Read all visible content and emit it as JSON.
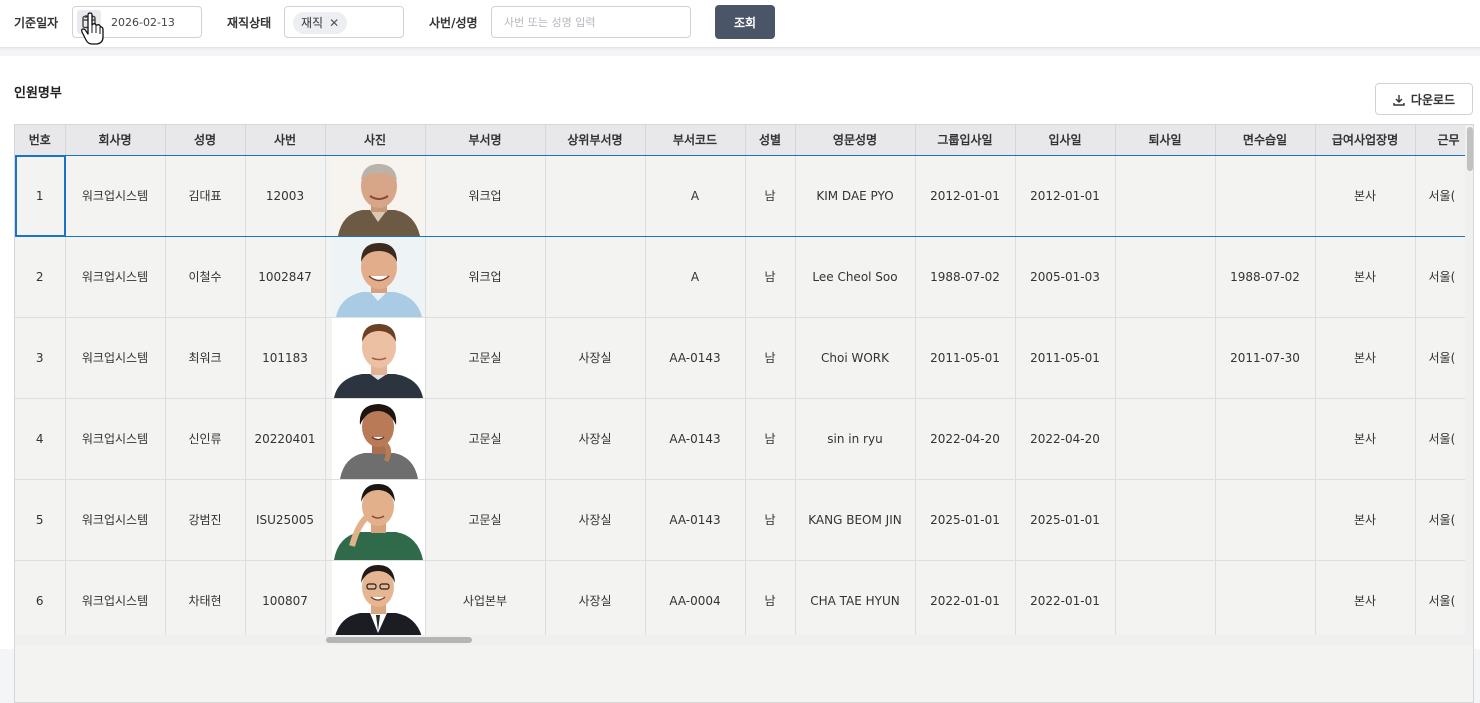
{
  "filters": {
    "date_label": "기준일자",
    "date_value": "2026-02-13",
    "status_label": "재직상태",
    "status_chip": "재직",
    "search_label": "사번/성명",
    "search_placeholder": "사번 또는 성명 입력",
    "search_button": "조회"
  },
  "panel": {
    "title": "인원명부",
    "download_button": "다운로드"
  },
  "table": {
    "columns": [
      "번호",
      "회사명",
      "성명",
      "사번",
      "사진",
      "부서명",
      "상위부서명",
      "부서코드",
      "성별",
      "영문성명",
      "그룹입사일",
      "입사일",
      "퇴사일",
      "면수습일",
      "급여사업장명",
      "근무"
    ],
    "rows": [
      {
        "no": "1",
        "company": "워크업시스템",
        "name": "김대표",
        "emp_no": "12003",
        "dept": "워크업",
        "parent_dept": "",
        "dept_code": "A",
        "gender": "남",
        "eng_name": "KIM DAE PYO",
        "group_join": "2012-01-01",
        "join": "2012-01-01",
        "leave": "",
        "probation_end": "",
        "payroll_site": "본사",
        "work_site": "서울("
      },
      {
        "no": "2",
        "company": "워크업시스템",
        "name": "이철수",
        "emp_no": "1002847",
        "dept": "워크업",
        "parent_dept": "",
        "dept_code": "A",
        "gender": "남",
        "eng_name": "Lee Cheol Soo",
        "group_join": "1988-07-02",
        "join": "2005-01-03",
        "leave": "",
        "probation_end": "1988-07-02",
        "payroll_site": "본사",
        "work_site": "서울("
      },
      {
        "no": "3",
        "company": "워크업시스템",
        "name": "최워크",
        "emp_no": "101183",
        "dept": "고문실",
        "parent_dept": "사장실",
        "dept_code": "AA-0143",
        "gender": "남",
        "eng_name": "Choi WORK",
        "group_join": "2011-05-01",
        "join": "2011-05-01",
        "leave": "",
        "probation_end": "2011-07-30",
        "payroll_site": "본사",
        "work_site": "서울("
      },
      {
        "no": "4",
        "company": "워크업시스템",
        "name": "신인류",
        "emp_no": "20220401",
        "dept": "고문실",
        "parent_dept": "사장실",
        "dept_code": "AA-0143",
        "gender": "남",
        "eng_name": "sin in ryu",
        "group_join": "2022-04-20",
        "join": "2022-04-20",
        "leave": "",
        "probation_end": "",
        "payroll_site": "본사",
        "work_site": "서울("
      },
      {
        "no": "5",
        "company": "워크업시스템",
        "name": "강범진",
        "emp_no": "ISU25005",
        "dept": "고문실",
        "parent_dept": "사장실",
        "dept_code": "AA-0143",
        "gender": "남",
        "eng_name": "KANG BEOM JIN",
        "group_join": "2025-01-01",
        "join": "2025-01-01",
        "leave": "",
        "probation_end": "",
        "payroll_site": "본사",
        "work_site": "서울("
      },
      {
        "no": "6",
        "company": "워크업시스템",
        "name": "차태현",
        "emp_no": "100807",
        "dept": "사업본부",
        "parent_dept": "사장실",
        "dept_code": "AA-0004",
        "gender": "남",
        "eng_name": "CHA TAE HYUN",
        "group_join": "2022-01-01",
        "join": "2022-01-01",
        "leave": "",
        "probation_end": "",
        "payroll_site": "본사",
        "work_site": "서울("
      }
    ]
  },
  "colors": {
    "primary_button": "#4a5568",
    "selection": "#1a73c7",
    "header_bg": "#e8e8ea"
  }
}
